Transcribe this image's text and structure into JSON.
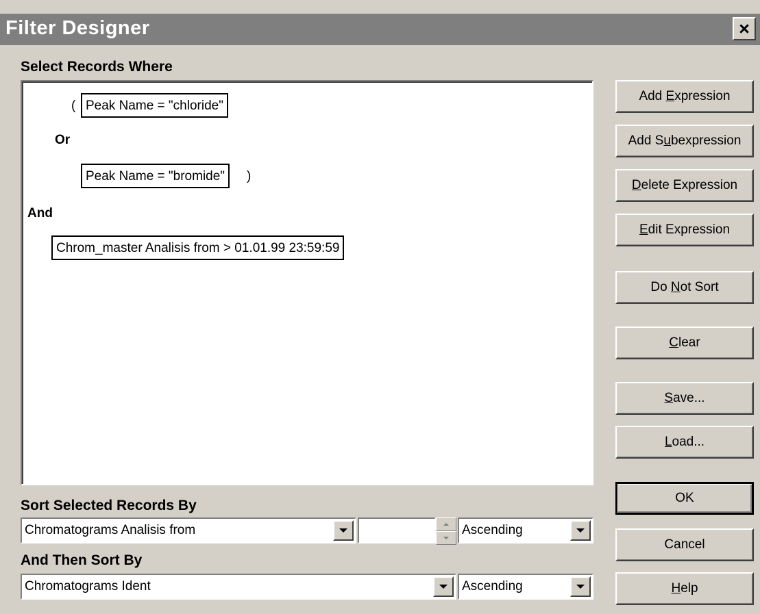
{
  "window": {
    "title": "Filter Designer",
    "close_label": "×"
  },
  "labels": {
    "select_records": "Select Records Where",
    "sort_by": "Sort Selected Records By",
    "then_sort_by": "And Then Sort By"
  },
  "expressions": {
    "open_paren": "(",
    "cond1": "Peak Name = \"chloride\"",
    "op_or": "Or",
    "cond2": "Peak Name = \"bromide\"",
    "close_paren": ")",
    "op_and": "And",
    "cond3": "Chrom_master Analisis from > 01.01.99 23:59:59"
  },
  "buttons": {
    "add_expression": {
      "pre": "Add ",
      "key": "E",
      "post": "xpression"
    },
    "add_subexpression": {
      "pre": "Add S",
      "key": "u",
      "post": "bexpression"
    },
    "delete_expression": {
      "pre": "",
      "key": "D",
      "post": "elete Expression"
    },
    "edit_expression": {
      "pre": "",
      "key": "E",
      "post": "dit Expression"
    },
    "do_not_sort": {
      "pre": "Do ",
      "key": "N",
      "post": "ot Sort"
    },
    "clear": {
      "pre": "",
      "key": "C",
      "post": "lear"
    },
    "save": {
      "pre": "",
      "key": "S",
      "post": "ave..."
    },
    "load": {
      "pre": "",
      "key": "L",
      "post": "oad..."
    },
    "ok": "OK",
    "cancel": "Cancel",
    "help": {
      "pre": "",
      "key": "H",
      "post": "elp"
    }
  },
  "sort": {
    "primary_field": "Chromatograms Analisis from",
    "primary_count": "",
    "primary_order": "Ascending",
    "secondary_field": "Chromatograms Ident",
    "secondary_order": "Ascending"
  },
  "icons": {
    "close": "close-icon",
    "dropdown": "chevron-down-icon",
    "spin_up": "spin-up-icon",
    "spin_down": "spin-down-icon"
  }
}
